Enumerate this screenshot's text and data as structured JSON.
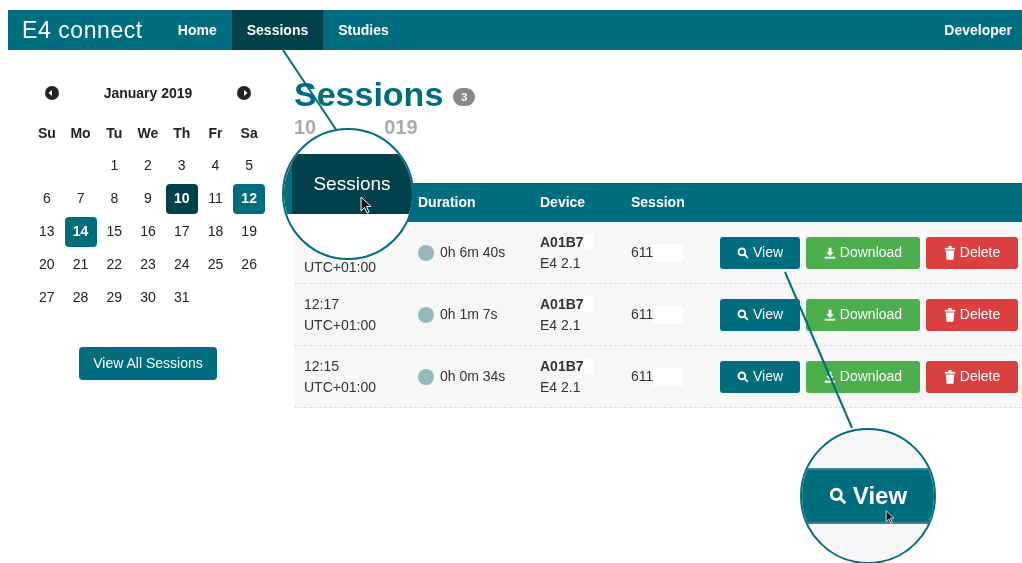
{
  "navbar": {
    "brand": "E4 connect",
    "items": [
      {
        "label": "Home",
        "selected": false
      },
      {
        "label": "Sessions",
        "selected": true
      },
      {
        "label": "Studies",
        "selected": false
      }
    ],
    "user": "Developer"
  },
  "calendar": {
    "month": "January 2019",
    "weekdays": [
      "Su",
      "Mo",
      "Tu",
      "We",
      "Th",
      "Fr",
      "Sa"
    ],
    "days": [
      {
        "day": "1",
        "selected": false,
        "has_sessions": false
      },
      {
        "day": "2",
        "selected": false,
        "has_sessions": false
      },
      {
        "day": "3",
        "selected": false,
        "has_sessions": false
      },
      {
        "day": "4",
        "selected": false,
        "has_sessions": false
      },
      {
        "day": "5",
        "selected": false,
        "has_sessions": false
      },
      {
        "day": "6",
        "selected": false,
        "has_sessions": false
      },
      {
        "day": "7",
        "selected": false,
        "has_sessions": false
      },
      {
        "day": "8",
        "selected": false,
        "has_sessions": false
      },
      {
        "day": "9",
        "selected": false,
        "has_sessions": false
      },
      {
        "day": "10",
        "selected": true,
        "has_sessions": true
      },
      {
        "day": "11",
        "selected": false,
        "has_sessions": false
      },
      {
        "day": "12",
        "selected": false,
        "has_sessions": true
      },
      {
        "day": "13",
        "selected": false,
        "has_sessions": false
      },
      {
        "day": "14",
        "selected": false,
        "has_sessions": true
      },
      {
        "day": "15",
        "selected": false,
        "has_sessions": false
      },
      {
        "day": "16",
        "selected": false,
        "has_sessions": false
      },
      {
        "day": "17",
        "selected": false,
        "has_sessions": false
      },
      {
        "day": "18",
        "selected": false,
        "has_sessions": false
      },
      {
        "day": "19",
        "selected": false,
        "has_sessions": false
      },
      {
        "day": "20",
        "selected": false,
        "has_sessions": false
      },
      {
        "day": "21",
        "selected": false,
        "has_sessions": false
      },
      {
        "day": "22",
        "selected": false,
        "has_sessions": false
      },
      {
        "day": "23",
        "selected": false,
        "has_sessions": false
      },
      {
        "day": "24",
        "selected": false,
        "has_sessions": false
      },
      {
        "day": "25",
        "selected": false,
        "has_sessions": false
      },
      {
        "day": "26",
        "selected": false,
        "has_sessions": false
      },
      {
        "day": "27",
        "selected": false,
        "has_sessions": false
      },
      {
        "day": "28",
        "selected": false,
        "has_sessions": false
      },
      {
        "day": "29",
        "selected": false,
        "has_sessions": false
      },
      {
        "day": "30",
        "selected": false,
        "has_sessions": false
      },
      {
        "day": "31",
        "selected": false,
        "has_sessions": false
      }
    ],
    "button": "View All Sessions"
  },
  "page": {
    "title": "Sessions",
    "count": "3",
    "subtitle_start": "10",
    "subtitle_end": "019"
  },
  "table": {
    "columns": [
      "Duration",
      "Device",
      "Session"
    ],
    "rows": [
      {
        "time": "",
        "zone": "UTC+01:00",
        "duration": "0h 6m 40s",
        "device": "A01B7",
        "version": "E4 2.1",
        "session": "611",
        "actions": [
          "View",
          "Download",
          "Delete"
        ]
      },
      {
        "time": "12:17",
        "zone": "UTC+01:00",
        "duration": "0h 1m 7s",
        "device": "A01B7",
        "version": "E4 2.1",
        "session": "611",
        "actions": [
          "View",
          "Download",
          "Delete"
        ]
      },
      {
        "time": "12:15",
        "zone": "UTC+01:00",
        "duration": "0h 0m 34s",
        "device": "A01B7",
        "version": "E4 2.1",
        "session": "611",
        "actions": [
          "View",
          "Download",
          "Delete"
        ]
      }
    ]
  },
  "callouts": [
    {
      "label": "Sessions"
    },
    {
      "label": "View"
    }
  ]
}
